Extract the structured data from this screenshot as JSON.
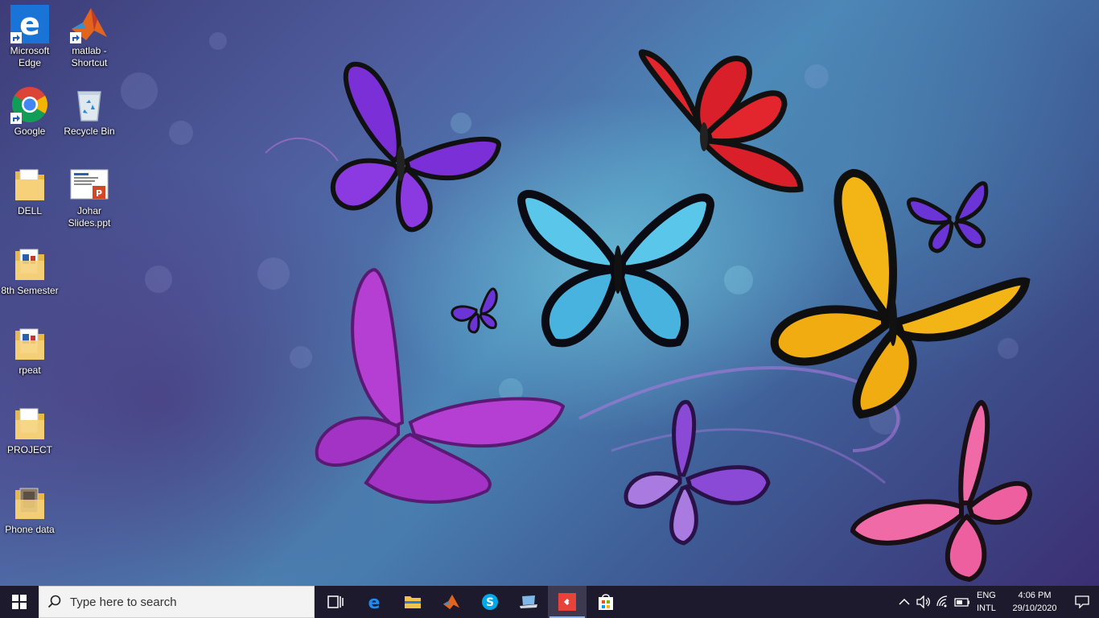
{
  "desktop": {
    "icons": [
      {
        "label": "Microsoft Edge",
        "icon": "edge-icon",
        "shortcut": true
      },
      {
        "label": "matlab - Shortcut",
        "icon": "matlab-icon",
        "shortcut": true
      },
      {
        "label": "Google",
        "icon": "chrome-icon",
        "shortcut": true
      },
      {
        "label": "Recycle Bin",
        "icon": "recycle-bin-icon",
        "shortcut": false
      },
      {
        "label": "DELL",
        "icon": "folder-icon",
        "shortcut": false
      },
      {
        "label": "Johar Slides.ppt",
        "icon": "powerpoint-file-icon",
        "shortcut": false
      },
      {
        "label": "8th Semester",
        "icon": "folder-icon",
        "shortcut": false
      },
      {
        "label": "rpeat",
        "icon": "folder-icon",
        "shortcut": false
      },
      {
        "label": "PROJECT",
        "icon": "folder-icon",
        "shortcut": false
      },
      {
        "label": "Phone data",
        "icon": "folder-icon",
        "shortcut": false
      }
    ]
  },
  "taskbar": {
    "start_icon": "windows-start-icon",
    "search": {
      "placeholder": "Type here to search",
      "icon": "search-icon"
    },
    "apps": [
      {
        "name": "task-view",
        "icon": "task-view-icon"
      },
      {
        "name": "edge",
        "icon": "edge-icon"
      },
      {
        "name": "file-explorer",
        "icon": "folder-icon"
      },
      {
        "name": "matlab",
        "icon": "matlab-icon"
      },
      {
        "name": "skype",
        "icon": "skype-icon"
      },
      {
        "name": "laptop-app",
        "icon": "laptop-icon"
      },
      {
        "name": "anydesk",
        "icon": "anydesk-icon",
        "active": true
      },
      {
        "name": "store",
        "icon": "store-icon"
      }
    ],
    "tray": {
      "icons": [
        "chevron-up-icon",
        "volume-icon",
        "wifi-icon",
        "battery-icon"
      ],
      "language_line1": "ENG",
      "language_line2": "INTL",
      "time": "4:06 PM",
      "date": "29/10/2020",
      "notification_icon": "notification-icon"
    }
  },
  "colors": {
    "taskbar": "#1d1a2e",
    "search_box": "#f3f3f3",
    "active_indicator": "#8fb4e8"
  }
}
